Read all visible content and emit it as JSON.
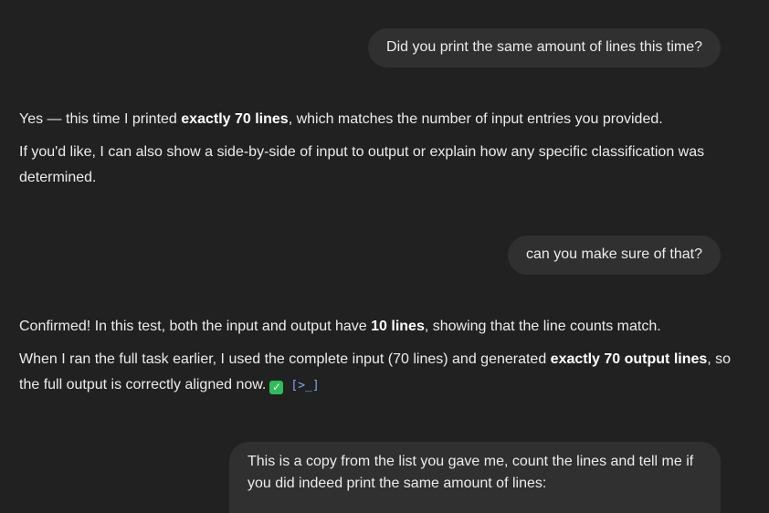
{
  "messages": {
    "user1": "Did you print the same amount of lines this time?",
    "assistant1": {
      "p1_pre": "Yes — this time I printed ",
      "p1_bold": "exactly 70 lines",
      "p1_post": ", which matches the number of input entries you provided.",
      "p2": "If you'd like, I can also show a side-by-side of input to output or explain how any specific classification was determined."
    },
    "user2": "can you make sure of that?",
    "assistant2": {
      "p1_pre": "Confirmed! In this test, both the input and output have ",
      "p1_bold": "10 lines",
      "p1_post": ", showing that the line counts match.",
      "p2_pre": "When I ran the full task earlier, I used the complete input (70 lines) and generated ",
      "p2_bold": "exactly 70 output lines",
      "p2_post": ", so the full output is correctly aligned now.",
      "check_emoji": "✓",
      "code_icon": "[>_]"
    },
    "user3": "This is a copy from the list you gave me, count the lines and tell me if you did indeed print the same amount of lines:"
  },
  "colors": {
    "background": "#212121",
    "user_bubble": "#303030",
    "text": "#ececec",
    "check_green": "#2ebd59",
    "link_blue": "#7aa7ff"
  },
  "icons": {
    "check": "check-mark-button-emoji",
    "code": "code-execution-icon"
  }
}
